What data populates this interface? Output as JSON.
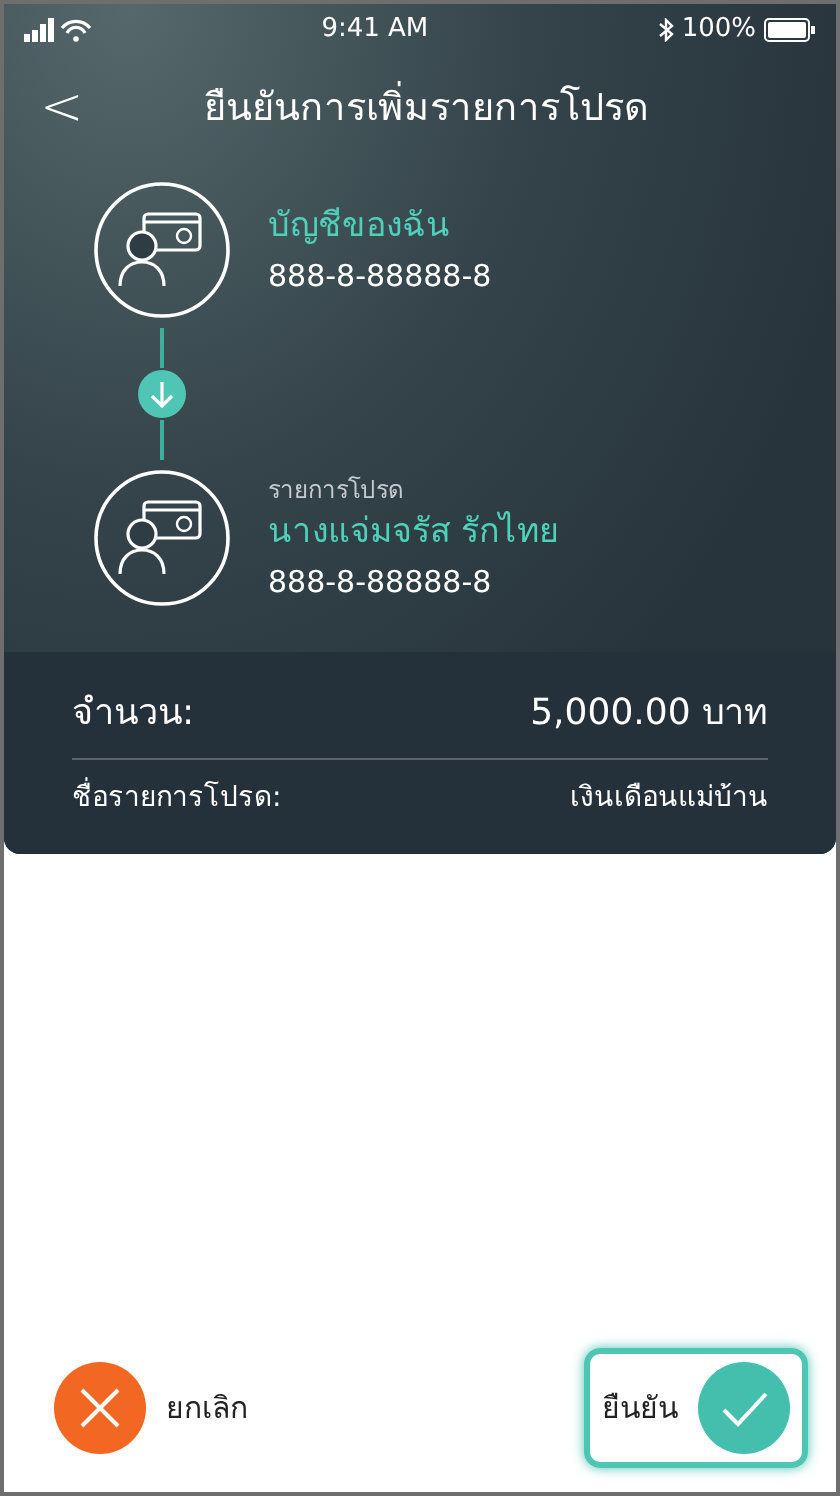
{
  "status_bar": {
    "time": "9:41 AM",
    "battery": "100%"
  },
  "header": {
    "back": "<",
    "title": "ยืนยันการเพิ่มรายการโปรด"
  },
  "accounts": [
    {
      "name": "บัญชีของฉัน",
      "number": "888-8-88888-8"
    },
    {
      "caption": "รายการโปรด",
      "name": "นางแจ่มจรัส รักไทย",
      "number": "888-8-88888-8"
    }
  ],
  "summary": [
    {
      "kind": "amount",
      "label": "จำนวน:",
      "value": "5,000.00 บาท"
    },
    {
      "kind": "detail",
      "label": "ชื่อรายการโปรด:",
      "value": "เงินเดือนแม่บ้าน"
    }
  ],
  "buttons": [
    {
      "kind": "cancel",
      "label": "ยกเลิก",
      "selected": false
    },
    {
      "kind": "confirm",
      "label": "ยืนยัน",
      "selected": true
    }
  ]
}
